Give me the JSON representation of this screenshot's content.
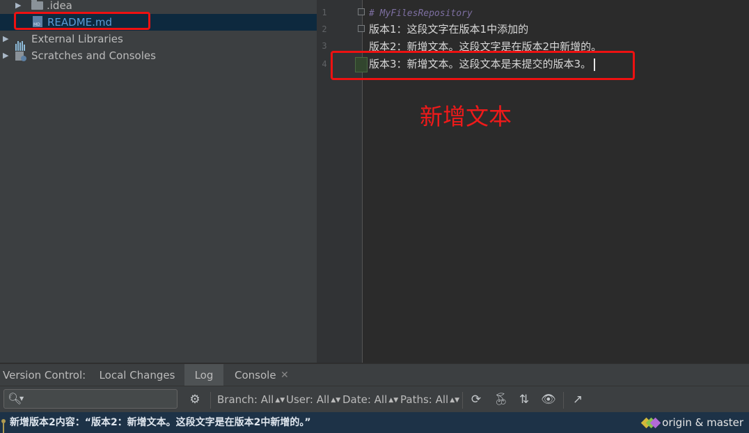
{
  "project_tree": {
    "items": [
      {
        "label": ".idea",
        "type": "folder"
      },
      {
        "label": "README.md",
        "type": "file"
      },
      {
        "label": "External Libraries",
        "type": "libraries"
      },
      {
        "label": "Scratches and Consoles",
        "type": "scratches"
      }
    ]
  },
  "editor": {
    "line_numbers": [
      "1",
      "2",
      "3",
      "4"
    ],
    "lines": [
      "# MyFilesRepository",
      "版本1：这段文字在版本1中添加的",
      "版本2：新增文本。这段文字是在版本2中新增的。",
      "版本3：新增文本。这段文本是未提交的版本3。"
    ]
  },
  "annotation": "新增文本",
  "version_control": {
    "label": "Version Control:",
    "tabs": [
      "Local Changes",
      "Log",
      "Console"
    ],
    "active_tab": "Log"
  },
  "toolbar": {
    "search_placeholder": "",
    "filters": [
      "Branch: All",
      "User: All",
      "Date: All",
      "Paths: All"
    ]
  },
  "status": {
    "commit_message": "新增版本2内容：“版本2：新增文本。这段文字是在版本2中新增的。”",
    "branch": "origin & master"
  },
  "colors": {
    "accent_red": "#ee1111",
    "selection": "#0d293e",
    "comment": "#7d6fa1"
  }
}
